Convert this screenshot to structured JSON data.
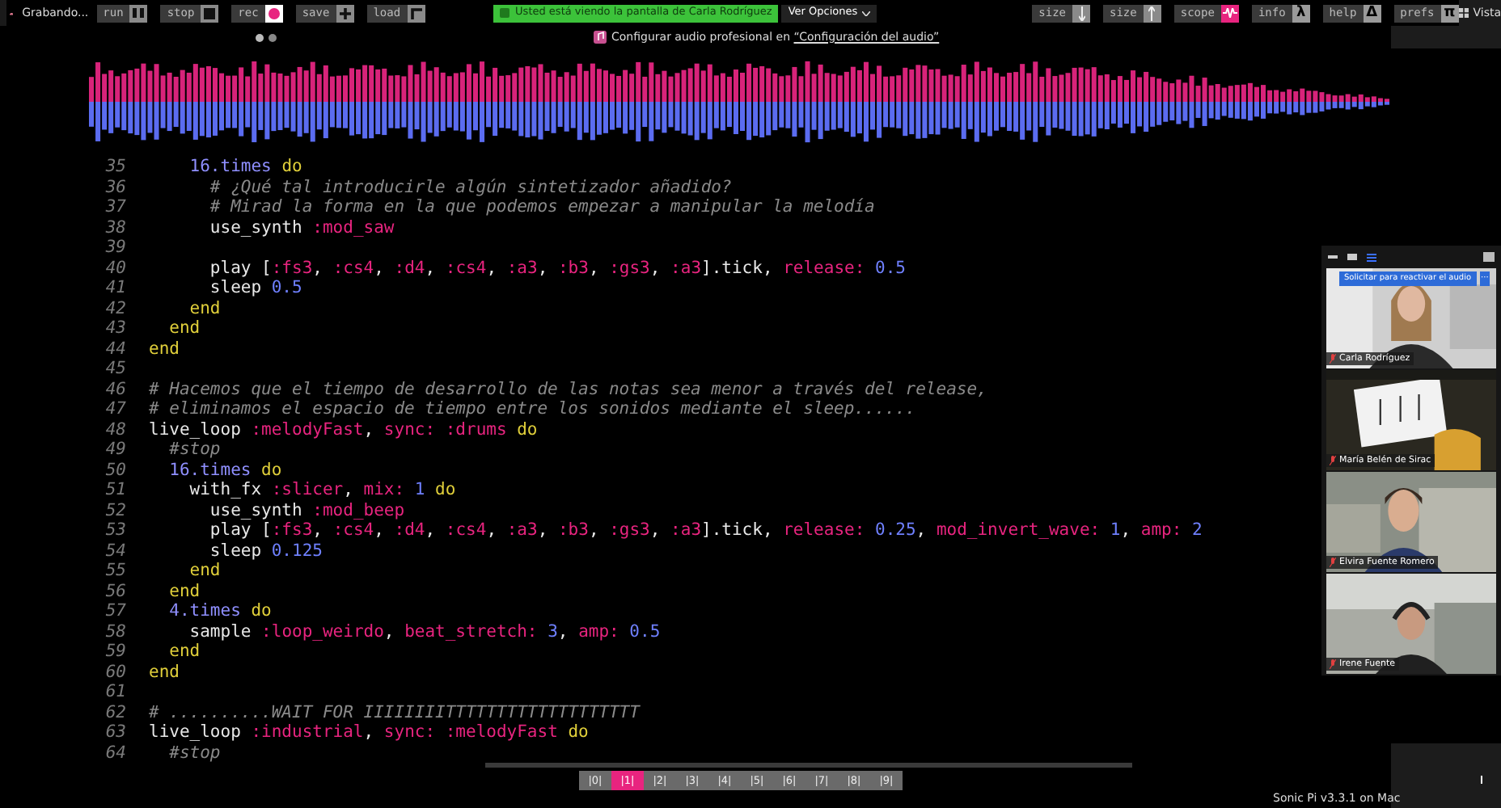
{
  "zoom_bar": {
    "recording": "Grabando...",
    "banner": "Usted está viendo la pantalla de Carla Rodríguez",
    "options": "Ver Opciones",
    "view": "Vista"
  },
  "audio_notice": {
    "text": "Configurar audio profesional en ",
    "link": "“Configuración del audio”"
  },
  "toolbar_left": [
    {
      "label": "run",
      "kind": "pause",
      "active": false
    },
    {
      "label": "stop",
      "kind": "stop",
      "active": false
    },
    {
      "label": "rec",
      "kind": "record",
      "active": true
    },
    {
      "label": "save",
      "kind": "plus",
      "active": false
    },
    {
      "label": "load",
      "kind": "load",
      "active": false
    }
  ],
  "toolbar_right": [
    {
      "label": "size",
      "kind": "shrink",
      "active": false
    },
    {
      "label": "size",
      "kind": "grow",
      "active": false
    },
    {
      "label": "scope",
      "kind": "wave",
      "active": true
    },
    {
      "label": "info",
      "glyph": "λ",
      "active": false
    },
    {
      "label": "help",
      "glyph": "Δ",
      "active": false
    },
    {
      "label": "prefs",
      "glyph": "π",
      "active": false
    }
  ],
  "editor": {
    "lines": [
      {
        "number": "35",
        "tokens": [
          {
            "kind": "method",
            "text": "    16.times "
          },
          {
            "kind": "keyword",
            "text": "do"
          }
        ]
      },
      {
        "number": "36",
        "tokens": [
          {
            "kind": "comment",
            "text": "      # ¿Qué tal introducirle algún sintetizador añadido?"
          }
        ]
      },
      {
        "number": "37",
        "tokens": [
          {
            "kind": "comment",
            "text": "      # Mirad la forma en la que podemos empezar a manipular la melodía"
          }
        ]
      },
      {
        "number": "38",
        "tokens": [
          {
            "kind": "plain",
            "text": "      use_synth "
          },
          {
            "kind": "symbol",
            "text": ":mod_saw"
          }
        ]
      },
      {
        "number": "39"
      },
      {
        "number": "40",
        "tokens": [
          {
            "kind": "plain",
            "text": "      play ["
          },
          {
            "kind": "symbol",
            "text": ":fs3"
          },
          {
            "kind": "plain",
            "text": ", "
          },
          {
            "kind": "symbol",
            "text": ":cs4"
          },
          {
            "kind": "plain",
            "text": ", "
          },
          {
            "kind": "symbol",
            "text": ":d4"
          },
          {
            "kind": "plain",
            "text": ", "
          },
          {
            "kind": "symbol",
            "text": ":cs4"
          },
          {
            "kind": "plain",
            "text": ", "
          },
          {
            "kind": "symbol",
            "text": ":a3"
          },
          {
            "kind": "plain",
            "text": ", "
          },
          {
            "kind": "symbol",
            "text": ":b3"
          },
          {
            "kind": "plain",
            "text": ", "
          },
          {
            "kind": "symbol",
            "text": ":gs3"
          },
          {
            "kind": "plain",
            "text": ", "
          },
          {
            "kind": "symbol",
            "text": ":a3"
          },
          {
            "kind": "plain",
            "text": "].tick, "
          },
          {
            "kind": "symbol",
            "text": "release: "
          },
          {
            "kind": "number",
            "text": "0.5"
          }
        ]
      },
      {
        "number": "41",
        "tokens": [
          {
            "kind": "plain",
            "text": "      sleep "
          },
          {
            "kind": "number",
            "text": "0.5"
          }
        ]
      },
      {
        "number": "42",
        "tokens": [
          {
            "kind": "keyword",
            "text": "    end"
          }
        ]
      },
      {
        "number": "43",
        "tokens": [
          {
            "kind": "keyword",
            "text": "  end"
          }
        ]
      },
      {
        "number": "44",
        "tokens": [
          {
            "kind": "keyword",
            "text": "end"
          }
        ]
      },
      {
        "number": "45"
      },
      {
        "number": "46",
        "tokens": [
          {
            "kind": "comment",
            "text": "# Hacemos que el tiempo de desarrollo de las notas sea menor a través del release,"
          }
        ]
      },
      {
        "number": "47",
        "tokens": [
          {
            "kind": "comment",
            "text": "# eliminamos el espacio de tiempo entre los sonidos mediante el sleep......"
          }
        ]
      },
      {
        "number": "48",
        "tokens": [
          {
            "kind": "plain",
            "text": "live_loop "
          },
          {
            "kind": "symbol",
            "text": ":melodyFast"
          },
          {
            "kind": "plain",
            "text": ", "
          },
          {
            "kind": "symbol",
            "text": "sync: :drums "
          },
          {
            "kind": "keyword",
            "text": "do"
          }
        ]
      },
      {
        "number": "49",
        "tokens": [
          {
            "kind": "comment",
            "text": "  #stop"
          }
        ]
      },
      {
        "number": "50",
        "tokens": [
          {
            "kind": "method",
            "text": "  16.times "
          },
          {
            "kind": "keyword",
            "text": "do"
          }
        ]
      },
      {
        "number": "51",
        "tokens": [
          {
            "kind": "plain",
            "text": "    with_fx "
          },
          {
            "kind": "symbol",
            "text": ":slicer"
          },
          {
            "kind": "plain",
            "text": ", "
          },
          {
            "kind": "symbol",
            "text": "mix: "
          },
          {
            "kind": "number",
            "text": "1 "
          },
          {
            "kind": "keyword",
            "text": "do"
          }
        ]
      },
      {
        "number": "52",
        "tokens": [
          {
            "kind": "plain",
            "text": "      use_synth "
          },
          {
            "kind": "symbol",
            "text": ":mod_beep"
          }
        ]
      },
      {
        "number": "53",
        "tokens": [
          {
            "kind": "plain",
            "text": "      play ["
          },
          {
            "kind": "symbol",
            "text": ":fs3"
          },
          {
            "kind": "plain",
            "text": ", "
          },
          {
            "kind": "symbol",
            "text": ":cs4"
          },
          {
            "kind": "plain",
            "text": ", "
          },
          {
            "kind": "symbol",
            "text": ":d4"
          },
          {
            "kind": "plain",
            "text": ", "
          },
          {
            "kind": "symbol",
            "text": ":cs4"
          },
          {
            "kind": "plain",
            "text": ", "
          },
          {
            "kind": "symbol",
            "text": ":a3"
          },
          {
            "kind": "plain",
            "text": ", "
          },
          {
            "kind": "symbol",
            "text": ":b3"
          },
          {
            "kind": "plain",
            "text": ", "
          },
          {
            "kind": "symbol",
            "text": ":gs3"
          },
          {
            "kind": "plain",
            "text": ", "
          },
          {
            "kind": "symbol",
            "text": ":a3"
          },
          {
            "kind": "plain",
            "text": "].tick, "
          },
          {
            "kind": "symbol",
            "text": "release: "
          },
          {
            "kind": "number",
            "text": "0.25"
          },
          {
            "kind": "plain",
            "text": ", "
          },
          {
            "kind": "symbol",
            "text": "mod_invert_wave: "
          },
          {
            "kind": "number",
            "text": "1"
          },
          {
            "kind": "plain",
            "text": ", "
          },
          {
            "kind": "symbol",
            "text": "amp: "
          },
          {
            "kind": "number",
            "text": "2"
          }
        ]
      },
      {
        "number": "54",
        "tokens": [
          {
            "kind": "plain",
            "text": "      sleep "
          },
          {
            "kind": "number",
            "text": "0.125"
          }
        ]
      },
      {
        "number": "55",
        "tokens": [
          {
            "kind": "keyword",
            "text": "    end"
          }
        ]
      },
      {
        "number": "56",
        "tokens": [
          {
            "kind": "keyword",
            "text": "  end"
          }
        ]
      },
      {
        "number": "57",
        "tokens": [
          {
            "kind": "method",
            "text": "  4.times "
          },
          {
            "kind": "keyword",
            "text": "do"
          }
        ]
      },
      {
        "number": "58",
        "tokens": [
          {
            "kind": "plain",
            "text": "    sample "
          },
          {
            "kind": "symbol",
            "text": ":loop_weirdo"
          },
          {
            "kind": "plain",
            "text": ", "
          },
          {
            "kind": "symbol",
            "text": "beat_stretch: "
          },
          {
            "kind": "number",
            "text": "3"
          },
          {
            "kind": "plain",
            "text": ", "
          },
          {
            "kind": "symbol",
            "text": "amp: "
          },
          {
            "kind": "number",
            "text": "0.5"
          }
        ]
      },
      {
        "number": "59",
        "tokens": [
          {
            "kind": "keyword",
            "text": "  end"
          }
        ]
      },
      {
        "number": "60",
        "tokens": [
          {
            "kind": "keyword",
            "text": "end"
          }
        ]
      },
      {
        "number": "61"
      },
      {
        "number": "62",
        "tokens": [
          {
            "kind": "comment",
            "text": "# ..........WAIT FOR IIIIIIIITTTTTTTTTTTTTTTTTTT"
          }
        ]
      },
      {
        "number": "63",
        "tokens": [
          {
            "kind": "plain",
            "text": "live_loop "
          },
          {
            "kind": "symbol",
            "text": ":industrial"
          },
          {
            "kind": "plain",
            "text": ", "
          },
          {
            "kind": "symbol",
            "text": "sync: :melodyFast "
          },
          {
            "kind": "keyword",
            "text": "do"
          }
        ]
      },
      {
        "number": "64",
        "tokens": [
          {
            "kind": "comment",
            "text": "  #stop"
          }
        ]
      }
    ]
  },
  "buffers": [
    {
      "label": "|0|",
      "selected": false
    },
    {
      "label": "|1|",
      "selected": true
    },
    {
      "label": "|2|",
      "selected": false
    },
    {
      "label": "|3|",
      "selected": false
    },
    {
      "label": "|4|",
      "selected": false
    },
    {
      "label": "|5|",
      "selected": false
    },
    {
      "label": "|6|",
      "selected": false
    },
    {
      "label": "|7|",
      "selected": false
    },
    {
      "label": "|8|",
      "selected": false
    },
    {
      "label": "|9|",
      "selected": false
    }
  ],
  "version": "Sonic Pi v3.3.1 on Mac",
  "participants_panel": {
    "unmute_request": "Solicitar para reactivar el audio",
    "more": "···",
    "participants": [
      {
        "name": "Carla Rodríguez",
        "muted": true
      },
      {
        "name": "María Belén de Sirac",
        "muted": true
      },
      {
        "name": "Elvira Fuente Romero",
        "muted": true
      },
      {
        "name": "Irene Fuente",
        "muted": true
      }
    ]
  }
}
